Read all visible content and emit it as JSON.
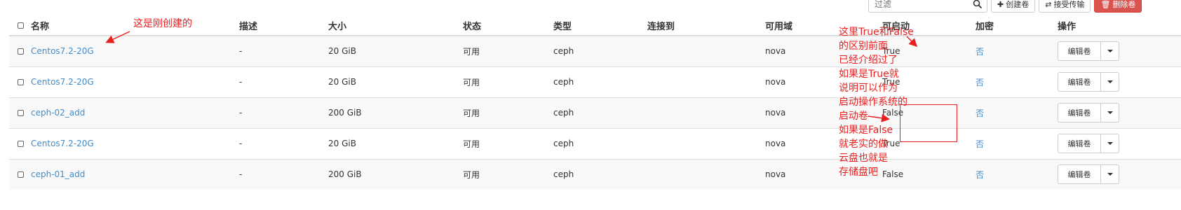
{
  "toolbar": {
    "search_placeholder": "过滤",
    "create_label": "创建卷",
    "accept_transfer_label": "接受传输",
    "delete_label": "删除卷"
  },
  "headers": {
    "name": "名称",
    "description": "描述",
    "size": "大小",
    "status": "状态",
    "type": "类型",
    "attached_to": "连接到",
    "availability_zone": "可用域",
    "bootable": "可启动",
    "encrypted": "加密",
    "actions": "操作"
  },
  "rows": [
    {
      "name": "Centos7.2-20G",
      "description": "-",
      "size": "20 GiB",
      "status": "可用",
      "type": "ceph",
      "attached_to": "",
      "zone": "nova",
      "bootable": "True",
      "encrypted": "否",
      "action": "编辑卷"
    },
    {
      "name": "Centos7.2-20G",
      "description": "-",
      "size": "20 GiB",
      "status": "可用",
      "type": "ceph",
      "attached_to": "",
      "zone": "nova",
      "bootable": "True",
      "encrypted": "否",
      "action": "编辑卷"
    },
    {
      "name": "ceph-02_add",
      "description": "-",
      "size": "200 GiB",
      "status": "可用",
      "type": "ceph",
      "attached_to": "",
      "zone": "nova",
      "bootable": "False",
      "encrypted": "否",
      "action": "编辑卷"
    },
    {
      "name": "Centos7.2-20G",
      "description": "-",
      "size": "20 GiB",
      "status": "可用",
      "type": "ceph",
      "attached_to": "",
      "zone": "nova",
      "bootable": "True",
      "encrypted": "否",
      "action": "编辑卷"
    },
    {
      "name": "ceph-01_add",
      "description": "-",
      "size": "200 GiB",
      "status": "可用",
      "type": "ceph",
      "attached_to": "",
      "zone": "nova",
      "bootable": "False",
      "encrypted": "否",
      "action": "编辑卷"
    }
  ],
  "annotations": {
    "note_new": "这是刚创建的",
    "note_bootable": "这里True和False\n的区别前面\n已经介绍过了\n如果是True就\n说明可以作为\n启动操作系统的\n启动卷\n如果是False\n就老实的做\n云盘也就是\n存储盘吧"
  },
  "colors": {
    "link": "#428bca",
    "annotation": "#e8201f",
    "danger": "#d9534f"
  }
}
